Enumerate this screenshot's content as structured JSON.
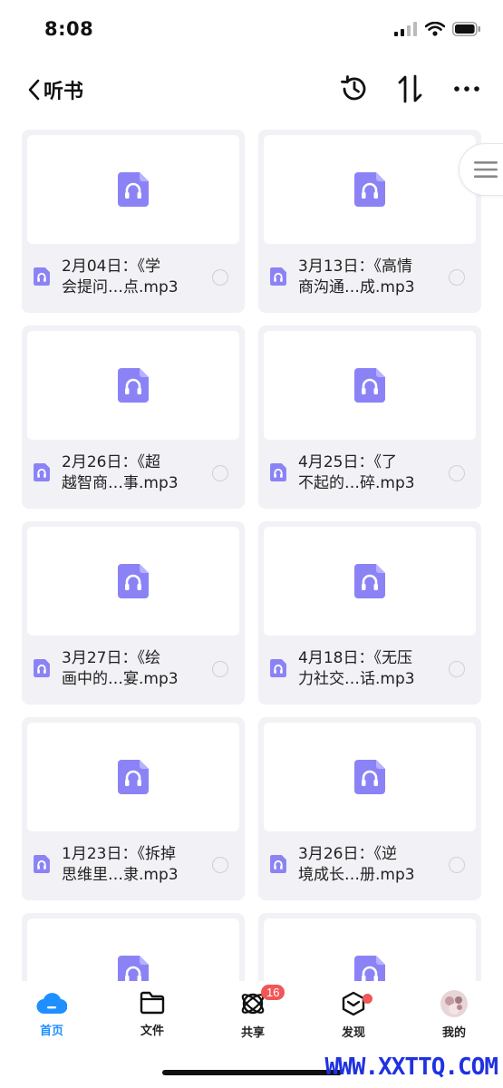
{
  "status": {
    "time": "8:08"
  },
  "nav": {
    "title": "听书"
  },
  "files": [
    {
      "line1": "2月04日：《学",
      "line2": "会提问…点.mp3"
    },
    {
      "line1": "3月13日：《高情",
      "line2": "商沟通…成.mp3"
    },
    {
      "line1": "2月26日：《超",
      "line2": "越智商…事.mp3"
    },
    {
      "line1": "4月25日：《了",
      "line2": "不起的…碎.mp3"
    },
    {
      "line1": "3月27日：《绘",
      "line2": "画中的…宴.mp3"
    },
    {
      "line1": "4月18日：《无压",
      "line2": "力社交…话.mp3"
    },
    {
      "line1": "1月23日：《拆掉",
      "line2": "思维里…隶.mp3"
    },
    {
      "line1": "3月26日：《逆",
      "line2": "境成长…册.mp3"
    },
    {
      "line1": "",
      "line2": ""
    },
    {
      "line1": "",
      "line2": ""
    }
  ],
  "tabs": [
    {
      "label": "首页",
      "icon": "cloud-icon",
      "active": true
    },
    {
      "label": "文件",
      "icon": "folder-icon"
    },
    {
      "label": "共享",
      "icon": "share-icon",
      "badge": "16"
    },
    {
      "label": "发现",
      "icon": "discover-icon",
      "dot": true
    },
    {
      "label": "我的",
      "icon": "avatar"
    }
  ],
  "watermark": "WWW.XXTTQ.COM",
  "colors": {
    "accent": "#1f8fff",
    "audio_icon": "#8b83f5",
    "badge": "#f25656"
  }
}
